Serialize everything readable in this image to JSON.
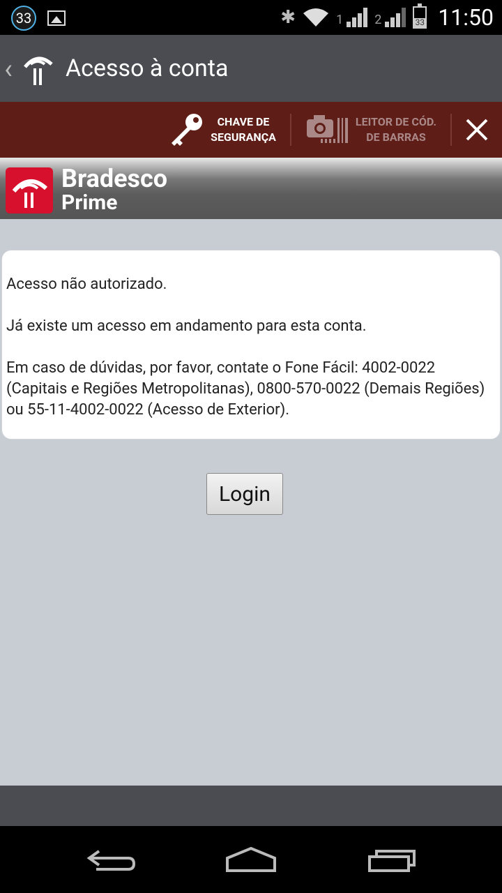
{
  "status_bar": {
    "notification_count": "33",
    "sim1_label": "1",
    "sim2_label": "2",
    "battery_level": "33",
    "time": "11:50"
  },
  "action_bar": {
    "title": "Acesso à conta"
  },
  "toolbar": {
    "security_key_line1": "CHAVE DE",
    "security_key_line2": "SEGURANÇA",
    "barcode_line1": "LEITOR DE CÓD.",
    "barcode_line2": "DE BARRAS"
  },
  "brand": {
    "name": "Bradesco",
    "sub": "Prime"
  },
  "message": {
    "line1": "Acesso não autorizado.",
    "line2": "Já existe um acesso em andamento para esta conta.",
    "line3": "Em caso de dúvidas, por favor, contate o Fone Fácil: 4002-0022 (Capitais e Regiões Metropolitanas), 0800-570-0022 (Demais Regiões) ou 55-11-4002-0022 (Acesso de Exterior)."
  },
  "login_button": {
    "label": "Login"
  }
}
